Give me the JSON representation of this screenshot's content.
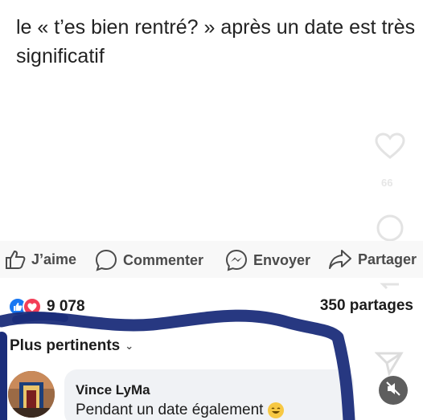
{
  "post": {
    "caption": "le « t’es bien rentré? » après un date est très significatif"
  },
  "side_actions": {
    "like_count": "66"
  },
  "actions": {
    "like_label": "J’aime",
    "comment_label": "Commenter",
    "send_label": "Envoyer",
    "share_label": "Partager"
  },
  "stats": {
    "reaction_count": "9 078",
    "shares": "350 partages"
  },
  "comments": {
    "filter_label": "Plus pertinents",
    "items": [
      {
        "author": "Vince LyMa",
        "text": "Pendant un date également"
      }
    ]
  },
  "colors": {
    "like_blue": "#1877f2",
    "love_red": "#f33e58",
    "scribble": "#1b2d7a"
  }
}
